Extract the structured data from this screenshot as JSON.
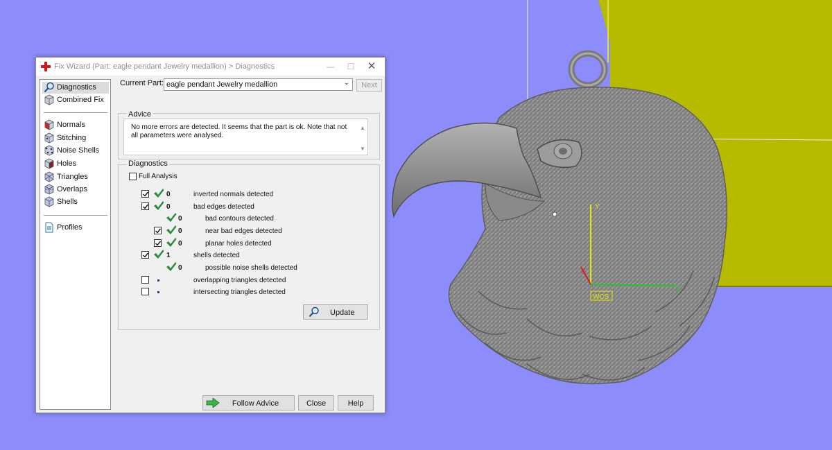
{
  "window": {
    "title": "Fix Wizard (Part: eagle pendant Jewelry medallion) > Diagnostics",
    "minimize_glyph": "—",
    "maximize_glyph": "☐",
    "close_glyph": "✕"
  },
  "sidebar": {
    "items": [
      {
        "label": "Diagnostics",
        "icon": "magnifier-icon",
        "active": true
      },
      {
        "label": "Combined Fix",
        "icon": "cube-icon"
      },
      {
        "label": "Normals",
        "icon": "normals-cube-icon"
      },
      {
        "label": "Stitching",
        "icon": "stitching-cube-icon"
      },
      {
        "label": "Noise Shells",
        "icon": "noise-shells-icon"
      },
      {
        "label": "Holes",
        "icon": "holes-cube-icon"
      },
      {
        "label": "Triangles",
        "icon": "triangles-cube-icon"
      },
      {
        "label": "Overlaps",
        "icon": "overlaps-cube-icon"
      },
      {
        "label": "Shells",
        "icon": "shells-cube-icon"
      },
      {
        "label": "Profiles",
        "icon": "document-icon"
      }
    ]
  },
  "current_part": {
    "label": "Current Part:",
    "value": "eagle pendant Jewelry medallion",
    "next_label": "Next"
  },
  "advice": {
    "group_label": "Advice",
    "text": "No more errors are detected. It seems that the part is ok. Note that not all parameters were analysed."
  },
  "diagnostics": {
    "group_label": "Diagnostics",
    "full_analysis_label": "Full Analysis",
    "full_analysis_checked": false,
    "rows": [
      {
        "label": "inverted normals detected",
        "count": "0",
        "checked": true,
        "status": "ok"
      },
      {
        "label": "bad edges detected",
        "count": "0",
        "checked": true,
        "status": "ok"
      },
      {
        "label": "bad contours detected",
        "count": "0",
        "checked": null,
        "status": "ok"
      },
      {
        "label": "near bad edges detected",
        "count": "0",
        "checked": true,
        "status": "ok"
      },
      {
        "label": "planar holes detected",
        "count": "0",
        "checked": true,
        "status": "ok"
      },
      {
        "label": "shells detected",
        "count": "1",
        "checked": true,
        "status": "ok"
      },
      {
        "label": "possible noise shells detected",
        "count": "0",
        "checked": null,
        "status": "ok"
      },
      {
        "label": "overlapping triangles detected",
        "count": "",
        "checked": false,
        "status": "not-analysed"
      },
      {
        "label": "intersecting triangles detected",
        "count": "",
        "checked": false,
        "status": "not-analysed"
      }
    ],
    "update_label": "Update"
  },
  "footer": {
    "follow_advice_label": "Follow Advice",
    "close_label": "Close",
    "help_label": "Help"
  },
  "viewport": {
    "background_color": "#8c8cfa",
    "platform_color": "#b7bb00",
    "model_color": "#8f8f8f",
    "axes": {
      "y_label": "Y",
      "x_label": "X",
      "z_label": "Z",
      "cs_label": "WCS"
    }
  }
}
